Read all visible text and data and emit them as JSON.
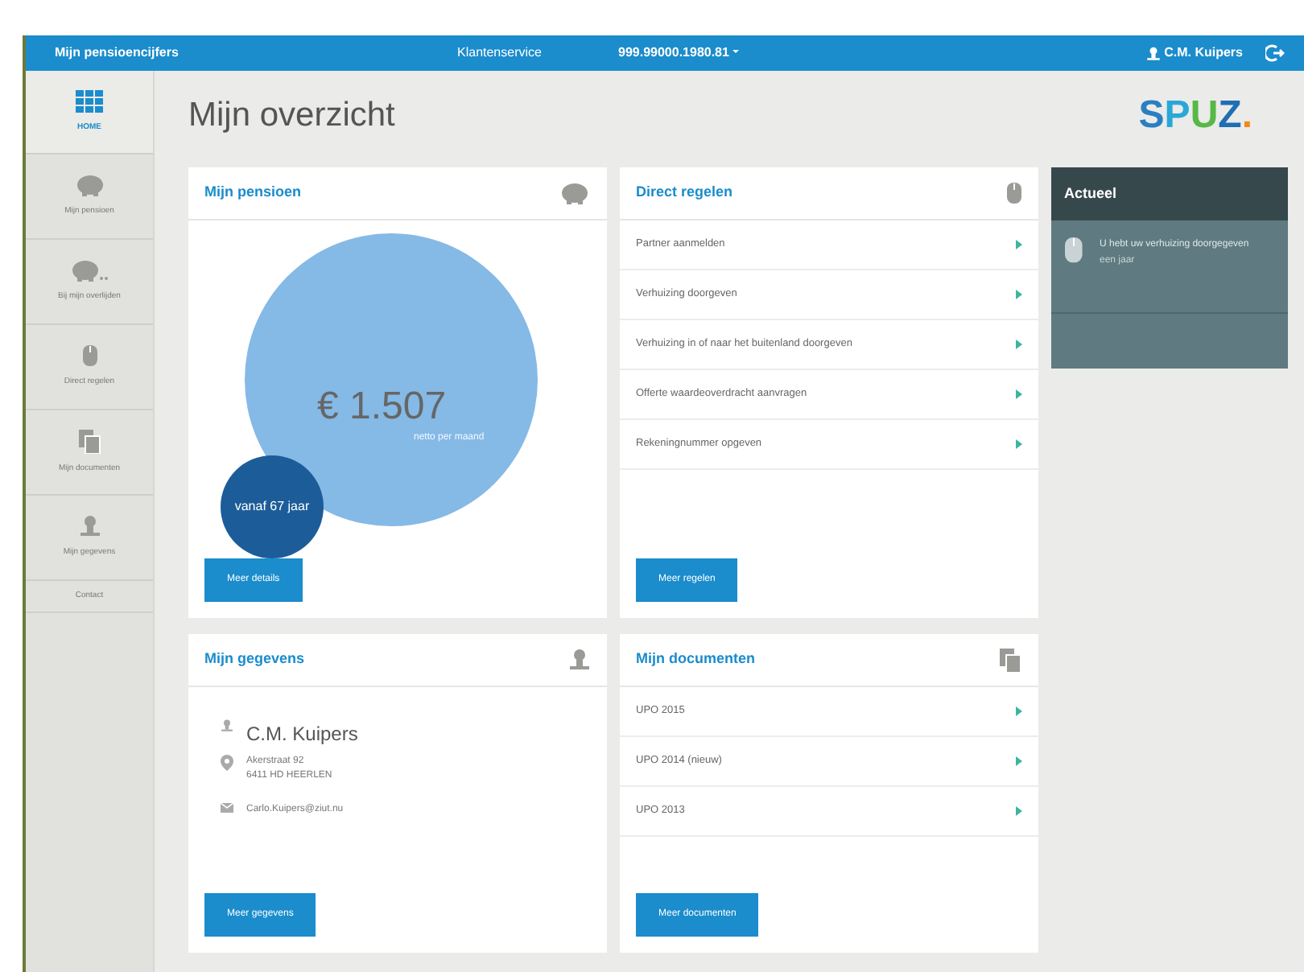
{
  "navbar": {
    "brand": "Mijn pensioencijfers",
    "center_link": "Klantenservice",
    "account": "999.99000.1980.81",
    "user": "C.M. Kuipers"
  },
  "sidebar": {
    "items": [
      {
        "label": "HOME",
        "selected": true
      },
      {
        "label": "Mijn pensioen",
        "selected": false
      },
      {
        "label": "Bij mijn overlijden",
        "selected": false
      },
      {
        "label": "Direct regelen",
        "selected": false
      },
      {
        "label": "Mijn documenten",
        "selected": false
      },
      {
        "label": "Mijn gegevens",
        "selected": false
      },
      {
        "label": "Contact",
        "selected": false
      }
    ]
  },
  "header": {
    "title": "Mijn overzicht",
    "logo": [
      {
        "text": "S",
        "color": "#2a7fc1"
      },
      {
        "text": "P",
        "color": "#29a8d8"
      },
      {
        "text": "U",
        "color": "#57b947"
      },
      {
        "text": "Z",
        "color": "#1f6fb2"
      },
      {
        "text": ".",
        "color": "#f08a1c"
      }
    ]
  },
  "pension": {
    "title": "Mijn pensioen",
    "amount": "€ 1.507",
    "amount_note": "netto per maand",
    "age_note": "vanaf 67 jaar",
    "button": "Meer details"
  },
  "direct": {
    "title": "Direct regelen",
    "items": [
      "Partner aanmelden",
      "Verhuizing doorgeven",
      "Verhuizing in of naar het buitenland doorgeven",
      "Offerte waardeoverdracht aanvragen",
      "Rekeningnummer opgeven"
    ],
    "button": "Meer regelen"
  },
  "actueel": {
    "title": "Actueel",
    "message": "U hebt uw verhuizing doorgegeven",
    "time": "een jaar"
  },
  "gegevens": {
    "title": "Mijn gegevens",
    "name": "C.M. Kuipers",
    "address": [
      "Akerstraat 92",
      "6411 HD HEERLEN"
    ],
    "email": "Carlo.Kuipers@ziut.nu",
    "button": "Meer gegevens"
  },
  "documents": {
    "title": "Mijn documenten",
    "items": [
      "UPO 2015",
      "UPO 2014 (nieuw)",
      "UPO 2013"
    ],
    "button": "Meer documenten"
  }
}
